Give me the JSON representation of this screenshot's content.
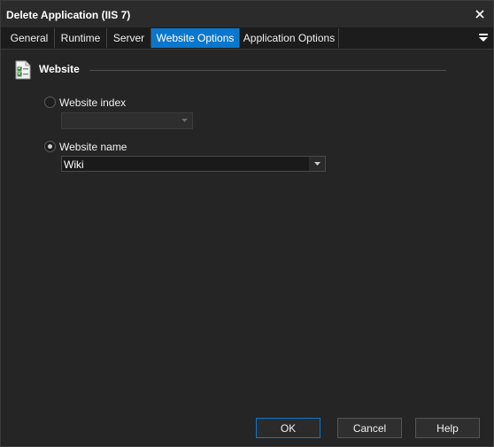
{
  "window": {
    "title": "Delete Application (IIS 7)"
  },
  "tabs": [
    {
      "label": "General"
    },
    {
      "label": "Runtime"
    },
    {
      "label": "Server"
    },
    {
      "label": "Website Options",
      "active": true
    },
    {
      "label": "Application Options"
    }
  ],
  "section": {
    "title": "Website"
  },
  "options": {
    "website_index": {
      "label": "Website index",
      "selected": false,
      "value": ""
    },
    "website_name": {
      "label": "Website name",
      "selected": true,
      "value": "Wiki"
    }
  },
  "buttons": {
    "ok": "OK",
    "cancel": "Cancel",
    "help": "Help"
  },
  "colors": {
    "accent": "#0b77cc",
    "background": "#252525",
    "tabbar": "#1c1c1c"
  },
  "icons": {
    "close": "close-icon",
    "menu": "hamburger-menu-icon",
    "section": "checklist-document-icon",
    "dropdown": "chevron-down-icon"
  }
}
